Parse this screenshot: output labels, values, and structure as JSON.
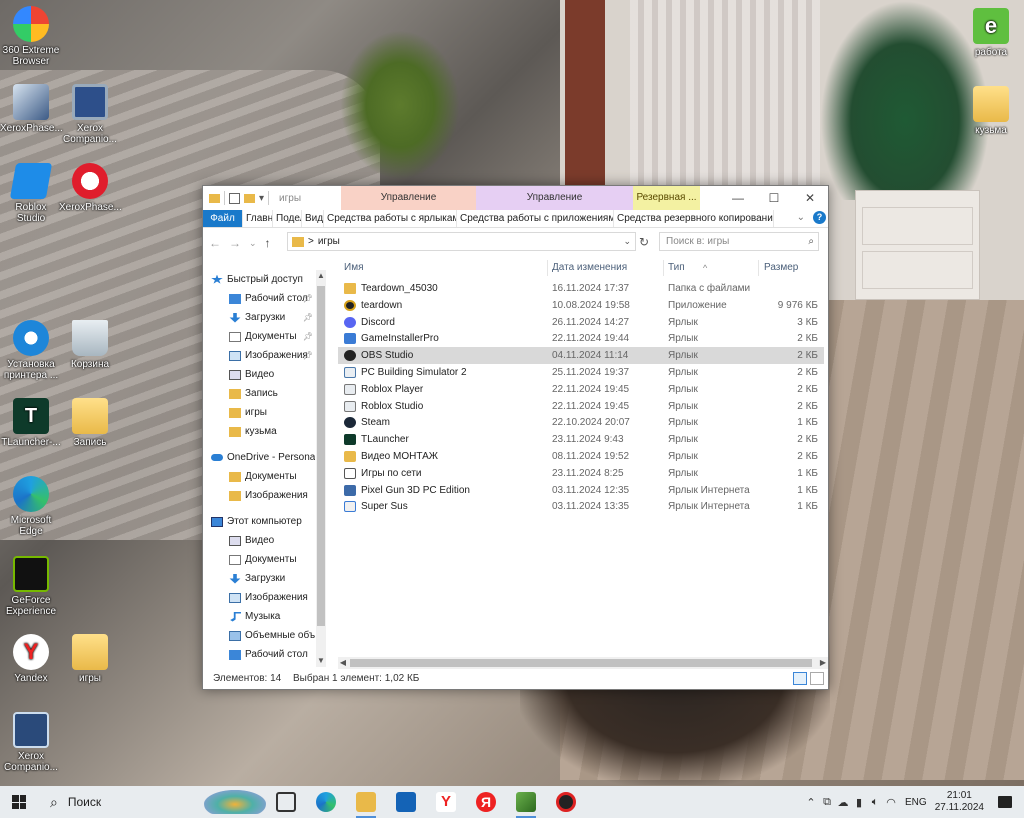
{
  "desktop": {
    "icons": [
      {
        "label": "360 Extreme Browser"
      },
      {
        "label": "XeroxPhase..."
      },
      {
        "label": "Xerox Companio..."
      },
      {
        "label": "Roblox Studio"
      },
      {
        "label": "XeroxPhase..."
      },
      {
        "label": "Установка принтера ..."
      },
      {
        "label": "Корзина"
      },
      {
        "label": "TLauncher-..."
      },
      {
        "label": "Запись"
      },
      {
        "label": "Microsoft Edge"
      },
      {
        "label": "GeForce Experience"
      },
      {
        "label": "Yandex"
      },
      {
        "label": "игры"
      },
      {
        "label": "Xerox Companio..."
      },
      {
        "label": "работа"
      },
      {
        "label": "кузьма"
      }
    ]
  },
  "explorer": {
    "title_path": "игры",
    "context_tabs": [
      "Управление",
      "Управление",
      "Резервная ..."
    ],
    "ribbon_tabs": [
      "Файл",
      "Главная",
      "Поделиться",
      "Вид",
      "Средства работы с ярлыками",
      "Средства работы с приложениями",
      "Средства резервного копирования"
    ],
    "help_glyph": "?",
    "address": {
      "separator": ">",
      "current": "игры"
    },
    "search_placeholder": "Поиск в: игры",
    "nav": {
      "items": [
        {
          "label": "Быстрый доступ",
          "icon": "star-icon",
          "pinned": false
        },
        {
          "label": "Рабочий стол",
          "icon": "desktop-icon",
          "pinned": true
        },
        {
          "label": "Загрузки",
          "icon": "download-icon",
          "pinned": true
        },
        {
          "label": "Документы",
          "icon": "document-icon",
          "pinned": true
        },
        {
          "label": "Изображения",
          "icon": "picture-icon",
          "pinned": true
        },
        {
          "label": "Видео",
          "icon": "video-icon",
          "pinned": false
        },
        {
          "label": "Запись",
          "icon": "folder-icon",
          "pinned": false
        },
        {
          "label": "игры",
          "icon": "folder-icon",
          "pinned": false
        },
        {
          "label": "кузьма",
          "icon": "folder-icon",
          "pinned": false
        },
        {
          "label": "OneDrive - Personal",
          "icon": "cloud-icon",
          "pinned": false
        },
        {
          "label": "Документы",
          "icon": "folder-icon",
          "pinned": false
        },
        {
          "label": "Изображения",
          "icon": "folder-icon",
          "pinned": false
        },
        {
          "label": "Этот компьютер",
          "icon": "computer-icon",
          "pinned": false
        },
        {
          "label": "Видео",
          "icon": "video-icon",
          "pinned": false
        },
        {
          "label": "Документы",
          "icon": "document-icon",
          "pinned": false
        },
        {
          "label": "Загрузки",
          "icon": "download-icon",
          "pinned": false
        },
        {
          "label": "Изображения",
          "icon": "picture-icon",
          "pinned": false
        },
        {
          "label": "Музыка",
          "icon": "music-icon",
          "pinned": false
        },
        {
          "label": "Объемные объекты",
          "icon": "cube-icon",
          "pinned": false
        },
        {
          "label": "Рабочий стол",
          "icon": "desktop-icon",
          "pinned": false
        }
      ]
    },
    "columns": {
      "name": "Имя",
      "date": "Дата изменения",
      "type": "Тип",
      "size": "Размер"
    },
    "files": [
      {
        "name": "Teardown_45030",
        "date": "16.11.2024 17:37",
        "type": "Папка с файлами",
        "size": "",
        "icon": "folder-icon"
      },
      {
        "name": "teardown",
        "date": "10.08.2024 19:58",
        "type": "Приложение",
        "size": "9 976 КБ",
        "icon": "teardown-icon"
      },
      {
        "name": "Discord",
        "date": "26.11.2024 14:27",
        "type": "Ярлык",
        "size": "3 КБ",
        "icon": "discord-icon"
      },
      {
        "name": "GameInstallerPro",
        "date": "22.11.2024 19:44",
        "type": "Ярлык",
        "size": "2 КБ",
        "icon": "installer-icon"
      },
      {
        "name": "OBS Studio",
        "date": "04.11.2024 11:14",
        "type": "Ярлык",
        "size": "2 КБ",
        "icon": "obs-icon",
        "selected": true
      },
      {
        "name": "PC Building Simulator 2",
        "date": "25.11.2024 19:37",
        "type": "Ярлык",
        "size": "2 КБ",
        "icon": "pcbs-icon"
      },
      {
        "name": "Roblox Player",
        "date": "22.11.2024 19:45",
        "type": "Ярлык",
        "size": "2 КБ",
        "icon": "roblox-icon"
      },
      {
        "name": "Roblox Studio",
        "date": "22.11.2024 19:45",
        "type": "Ярлык",
        "size": "2 КБ",
        "icon": "roblox-studio-icon"
      },
      {
        "name": "Steam",
        "date": "22.10.2024 20:07",
        "type": "Ярлык",
        "size": "1 КБ",
        "icon": "steam-icon"
      },
      {
        "name": "TLauncher",
        "date": "23.11.2024 9:43",
        "type": "Ярлык",
        "size": "2 КБ",
        "icon": "tlauncher-icon"
      },
      {
        "name": "Видео МОНТАЖ",
        "date": "08.11.2024 19:52",
        "type": "Ярлык",
        "size": "2 КБ",
        "icon": "video-editor-icon"
      },
      {
        "name": "Игры по сети",
        "date": "23.11.2024 8:25",
        "type": "Ярлык",
        "size": "1 КБ",
        "icon": "network-games-icon"
      },
      {
        "name": "Pixel Gun 3D PC Edition",
        "date": "03.11.2024 12:35",
        "type": "Ярлык Интернета",
        "size": "1 КБ",
        "icon": "pixelgun-icon"
      },
      {
        "name": "Super Sus",
        "date": "03.11.2024 13:35",
        "type": "Ярлык Интернета",
        "size": "1 КБ",
        "icon": "supersus-icon"
      }
    ],
    "status": {
      "count": "Элементов: 14",
      "selection": "Выбран 1 элемент: 1,02 КБ"
    }
  },
  "taskbar": {
    "search_label": "Поиск",
    "apps": [
      "task-view",
      "edge",
      "file-explorer",
      "outlook",
      "yandex-browser",
      "yandex",
      "minecraft",
      "roblox"
    ],
    "tray": {
      "language": "ENG",
      "time": "21:01",
      "date": "27.11.2024"
    }
  }
}
